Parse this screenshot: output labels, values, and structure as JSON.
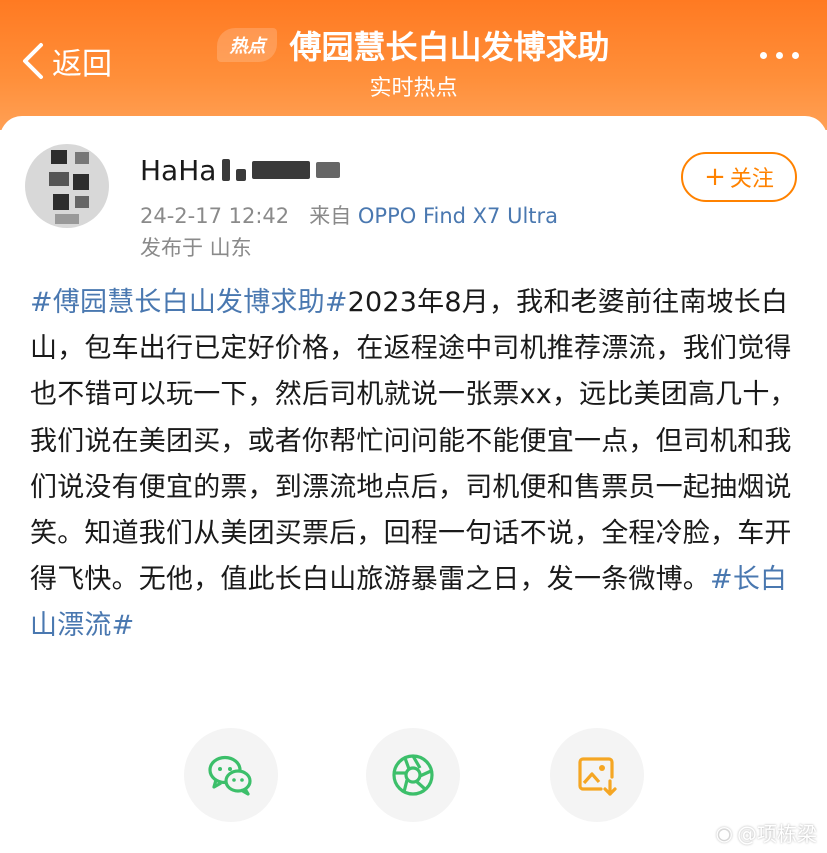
{
  "header": {
    "back_label": "返回",
    "badge": "热点",
    "title": "傅园慧长白山发博求助",
    "subtitle": "实时热点"
  },
  "post": {
    "author_name": "HaHa",
    "timestamp": "24-2-17 12:42",
    "source_prefix": "来自",
    "device": "OPPO Find X7 Ultra",
    "location": "发布于 山东",
    "follow_label": "关注",
    "tag_start": "#傅园慧长白山发博求助#",
    "body": "2023年8月，我和老婆前往南坡长白山，包车出行已定好价格，在返程途中司机推荐漂流，我们觉得也不错可以玩一下，然后司机就说一张票xx，远比美团高几十，我们说在美团买，或者你帮忙问问能不能便宜一点，但司机和我们说没有便宜的票，到漂流地点后，司机便和售票员一起抽烟说笑。知道我们从美团买票后，回程一句话不说，全程冷脸，车开得飞快。无他，值此长白山旅游暴雷之日，发一条微博。",
    "tag_end": "#长白山漂流#"
  },
  "share": {
    "icons": [
      "wechat-icon",
      "moments-icon",
      "save-image-icon"
    ]
  },
  "watermark": "@项栋梁",
  "colors": {
    "header_orange": "#ff7a22",
    "accent_orange": "#ff8200",
    "link_blue": "#4a78b0",
    "wechat_green": "#3cbf6a",
    "save_orange": "#f5a623"
  }
}
